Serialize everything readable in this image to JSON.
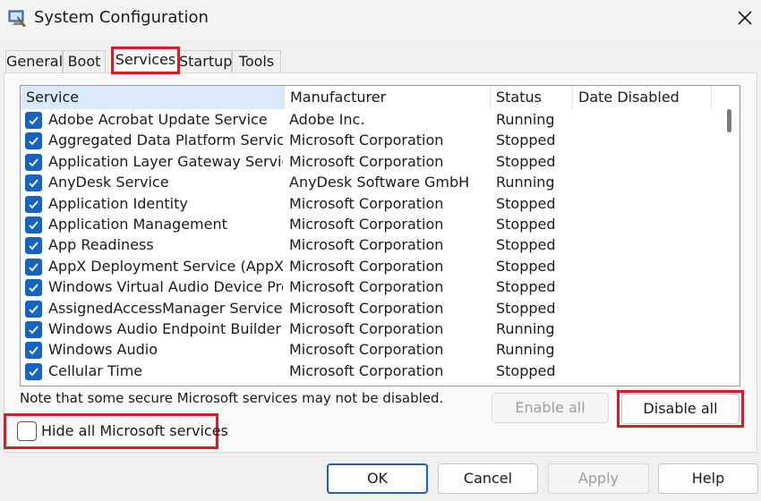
{
  "window": {
    "title": "System Configuration"
  },
  "tabs": [
    {
      "label": "General"
    },
    {
      "label": "Boot"
    },
    {
      "label": "Services"
    },
    {
      "label": "Startup"
    },
    {
      "label": "Tools"
    }
  ],
  "table": {
    "headers": {
      "service": "Service",
      "manufacturer": "Manufacturer",
      "status": "Status",
      "date_disabled": "Date Disabled"
    },
    "rows": [
      {
        "name": "Adobe Acrobat Update Service",
        "manufacturer": "Adobe Inc.",
        "status": "Running"
      },
      {
        "name": "Aggregated Data Platform Service",
        "manufacturer": "Microsoft Corporation",
        "status": "Stopped"
      },
      {
        "name": "Application Layer Gateway Service",
        "manufacturer": "Microsoft Corporation",
        "status": "Stopped"
      },
      {
        "name": "AnyDesk Service",
        "manufacturer": "AnyDesk Software GmbH",
        "status": "Running"
      },
      {
        "name": "Application Identity",
        "manufacturer": "Microsoft Corporation",
        "status": "Stopped"
      },
      {
        "name": "Application Management",
        "manufacturer": "Microsoft Corporation",
        "status": "Stopped"
      },
      {
        "name": "App Readiness",
        "manufacturer": "Microsoft Corporation",
        "status": "Stopped"
      },
      {
        "name": "AppX Deployment Service (AppXS...",
        "manufacturer": "Microsoft Corporation",
        "status": "Stopped"
      },
      {
        "name": "Windows Virtual Audio Device Pro...",
        "manufacturer": "Microsoft Corporation",
        "status": "Stopped"
      },
      {
        "name": "AssignedAccessManager Service",
        "manufacturer": "Microsoft Corporation",
        "status": "Stopped"
      },
      {
        "name": "Windows Audio Endpoint Builder",
        "manufacturer": "Microsoft Corporation",
        "status": "Running"
      },
      {
        "name": "Windows Audio",
        "manufacturer": "Microsoft Corporation",
        "status": "Running"
      },
      {
        "name": "Cellular Time",
        "manufacturer": "Microsoft Corporation",
        "status": "Stopped"
      }
    ]
  },
  "note": "Note that some secure Microsoft services may not be disabled.",
  "buttons": {
    "enable_all": "Enable all",
    "disable_all": "Disable all",
    "ok": "OK",
    "cancel": "Cancel",
    "apply": "Apply",
    "help": "Help"
  },
  "hide_ms": {
    "label": "Hide all Microsoft services",
    "checked": false
  },
  "colors": {
    "highlight": "#d81b24",
    "checkbox": "#1664c0",
    "header_selected": "#d9ebfa",
    "primary_border": "#1166c5"
  }
}
